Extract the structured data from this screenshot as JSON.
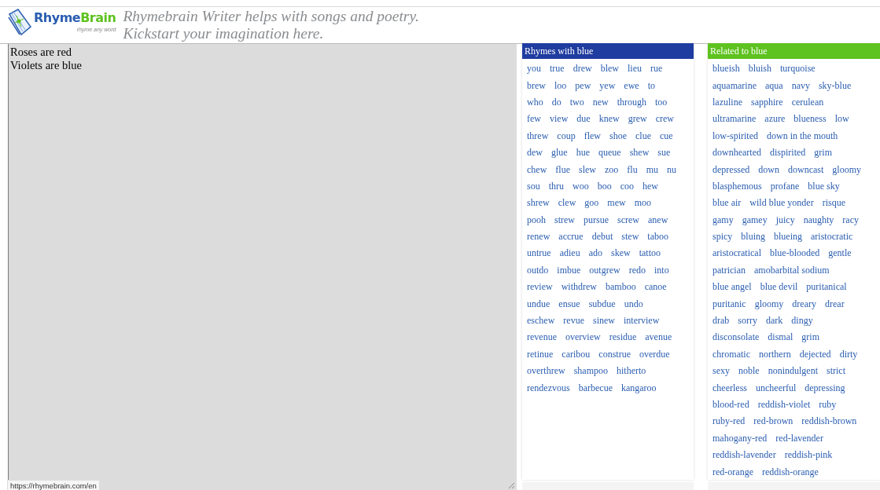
{
  "header": {
    "logo": {
      "wordmark": [
        "Rhyme",
        "Brain"
      ],
      "slogan": "rhyme any word"
    },
    "tagline": [
      "Rhymebrain Writer helps with songs and poetry.",
      "Kickstart your imagination here."
    ]
  },
  "editor": {
    "lines": [
      "Roses are red",
      "Violets are blue"
    ]
  },
  "panels": [
    {
      "kind": "rhymes",
      "title": "Rhymes with blue",
      "color": "#1f3ca0",
      "rows": [
        [
          "you",
          "true",
          "drew",
          "blew",
          "lieu",
          "rue"
        ],
        [
          "brew",
          "loo",
          "pew",
          "yew",
          "ewe",
          "to"
        ],
        [
          "who",
          "do",
          "two",
          "new",
          "through",
          "too"
        ],
        [
          "few",
          "view",
          "due",
          "knew",
          "grew",
          "crew"
        ],
        [
          "threw",
          "coup",
          "flew",
          "shoe",
          "clue",
          "cue"
        ],
        [
          "dew",
          "glue",
          "hue",
          "queue",
          "shew",
          "sue"
        ],
        [
          "chew",
          "flue",
          "slew",
          "zoo",
          "flu",
          "mu",
          "nu"
        ],
        [
          "sou",
          "thru",
          "woo",
          "boo",
          "coo",
          "hew"
        ],
        [
          "shrew",
          "clew",
          "goo",
          "mew",
          "moo"
        ],
        [
          "pooh",
          "strew",
          "pursue",
          "screw",
          "anew"
        ],
        [
          "renew",
          "accrue",
          "debut",
          "stew",
          "taboo"
        ],
        [
          "untrue",
          "adieu",
          "ado",
          "skew",
          "tattoo"
        ],
        [
          "outdo",
          "imbue",
          "outgrew",
          "redo",
          "into"
        ],
        [
          "review",
          "withdrew",
          "bamboo",
          "canoe"
        ],
        [
          "undue",
          "ensue",
          "subdue",
          "undo"
        ],
        [
          "eschew",
          "revue",
          "sinew",
          "interview"
        ],
        [
          "revenue",
          "overview",
          "residue",
          "avenue"
        ],
        [
          "retinue",
          "caribou",
          "construe",
          "overdue"
        ],
        [
          "overthrew",
          "shampoo",
          "hitherto"
        ],
        [
          "rendezvous",
          "barbecue",
          "kangaroo"
        ]
      ]
    },
    {
      "kind": "related",
      "title": "Related to blue",
      "color": "#5ec21f",
      "rows": [
        [
          "blueish",
          "bluish",
          "turquoise"
        ],
        [
          "aquamarine",
          "aqua",
          "navy",
          "sky-blue"
        ],
        [
          "lazuline",
          "sapphire",
          "cerulean"
        ],
        [
          "ultramarine",
          "azure",
          "blueness",
          "low"
        ],
        [
          "low-spirited",
          "down in the mouth"
        ],
        [
          "downhearted",
          "dispirited",
          "grim"
        ],
        [
          "depressed",
          "down",
          "downcast",
          "gloomy"
        ],
        [
          "blasphemous",
          "profane",
          "blue sky"
        ],
        [
          "blue air",
          "wild blue yonder",
          "risque"
        ],
        [
          "gamy",
          "gamey",
          "juicy",
          "naughty",
          "racy"
        ],
        [
          "spicy",
          "bluing",
          "blueing",
          "aristocratic"
        ],
        [
          "aristocratical",
          "blue-blooded",
          "gentle"
        ],
        [
          "patrician",
          "amobarbital sodium"
        ],
        [
          "blue angel",
          "blue devil",
          "puritanical"
        ],
        [
          "puritanic",
          "gloomy",
          "dreary",
          "drear"
        ],
        [
          "drab",
          "sorry",
          "dark",
          "dingy"
        ],
        [
          "disconsolate",
          "dismal",
          "grim"
        ],
        [
          "chromatic",
          "northern",
          "dejected",
          "dirty"
        ],
        [
          "sexy",
          "noble",
          "nonindulgent",
          "strict"
        ],
        [
          "cheerless",
          "uncheerful",
          "depressing"
        ],
        [
          "blood-red",
          "reddish-violet",
          "ruby"
        ],
        [
          "ruby-red",
          "red-brown",
          "reddish-brown"
        ],
        [
          "mahogany-red",
          "red-lavender"
        ],
        [
          "reddish-lavender",
          "reddish-pink"
        ],
        [
          "red-orange",
          "reddish-orange"
        ]
      ]
    }
  ],
  "status_bar": {
    "url": "https://rhymebrain.com/en"
  }
}
